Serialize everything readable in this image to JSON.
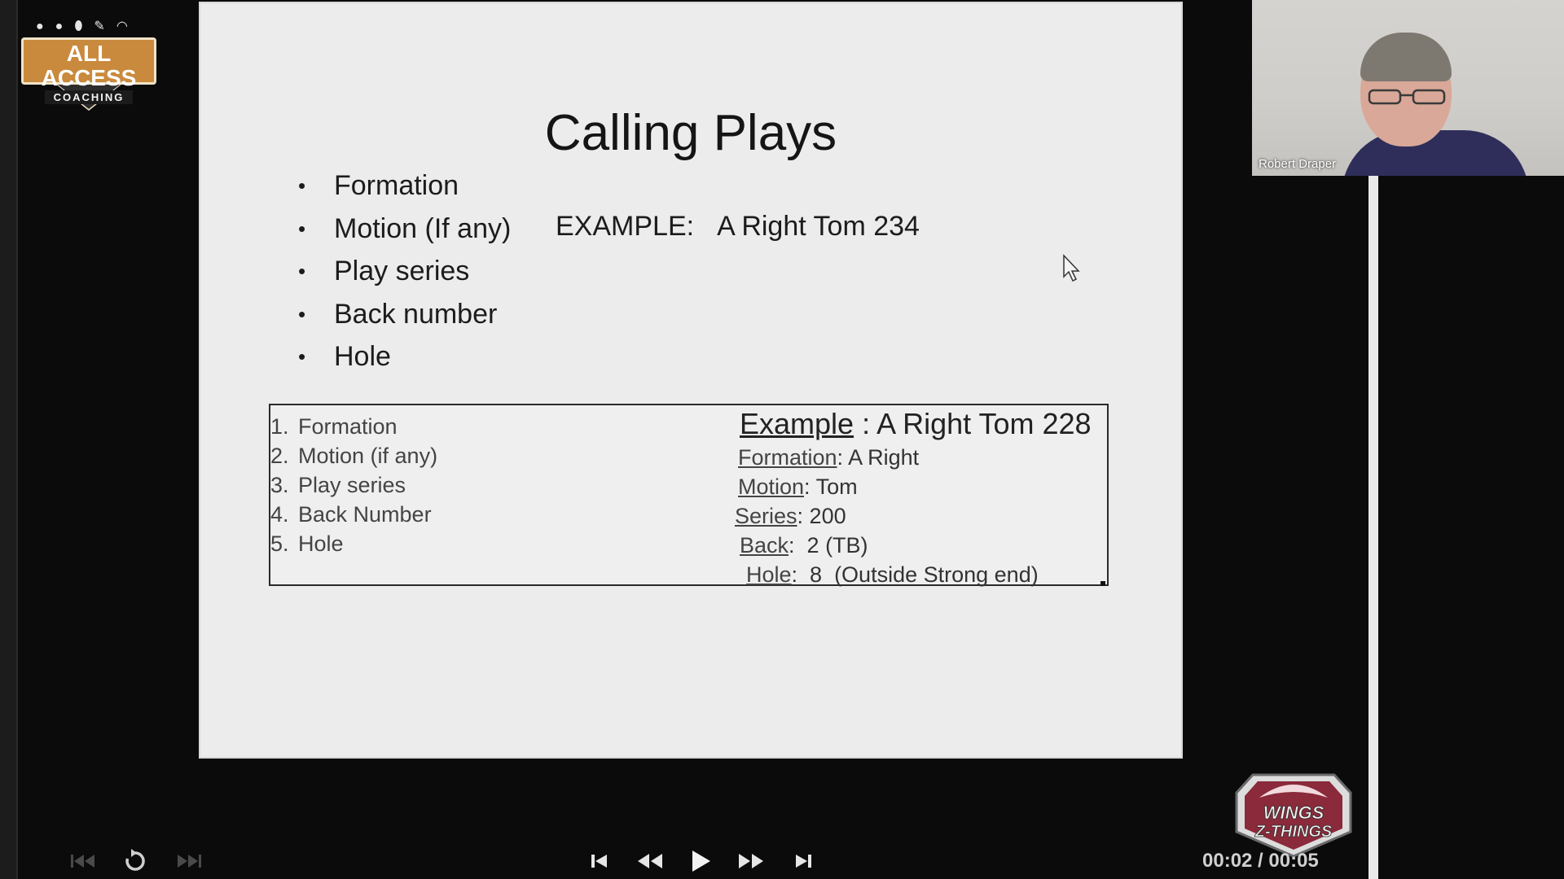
{
  "logo": {
    "line1": "ALL ACCESS",
    "line2": "COACHING",
    "icons": [
      "ball-dot-icon",
      "ball-dot-icon",
      "football-icon",
      "whistle-icon",
      "helmet-icon"
    ]
  },
  "slide": {
    "title": "Calling Plays",
    "bullets": [
      "Formation",
      "Motion (If any)",
      "Play series",
      "Back number",
      "Hole"
    ],
    "example_label": "EXAMPLE:",
    "example_value": "A Right Tom 234",
    "box": {
      "steps": [
        {
          "num": "1.",
          "label": "Formation"
        },
        {
          "num": "2.",
          "label": "Motion (if any)"
        },
        {
          "num": "3.",
          "label": "Play series"
        },
        {
          "num": "4.",
          "label": "Back Number"
        },
        {
          "num": "5.",
          "label": "Hole"
        }
      ],
      "example_heading_label": "Example",
      "example_heading_value": " : A Right Tom 228",
      "example_rows": [
        {
          "key": "Formation",
          "sep": ": ",
          "value": "A Right"
        },
        {
          "key": "Motion",
          "sep": ": ",
          "value": "Tom"
        },
        {
          "key": "Series",
          "sep": ": ",
          "value": "200"
        },
        {
          "key": "Back",
          "sep": ":  ",
          "value": "2 (TB)"
        },
        {
          "key": "Hole",
          "sep": ":  ",
          "value": "8  (Outside Strong end)"
        }
      ]
    }
  },
  "webcam": {
    "participant_name": "Robert Draper"
  },
  "sponsor_logo": {
    "line1": "WINGS",
    "line2": "Z-THINGS"
  },
  "player": {
    "controls": [
      "skip-to-start-icon",
      "replay-icon",
      "skip-to-end-icon",
      "previous-icon",
      "rewind-icon",
      "play-icon",
      "fast-forward-icon",
      "next-icon"
    ],
    "timecode": "00:02 / 00:05"
  },
  "colors": {
    "logo_gold": "#c98a3d",
    "slide_bg": "#ececec",
    "sponsor_maroon": "#8a2a3a"
  }
}
